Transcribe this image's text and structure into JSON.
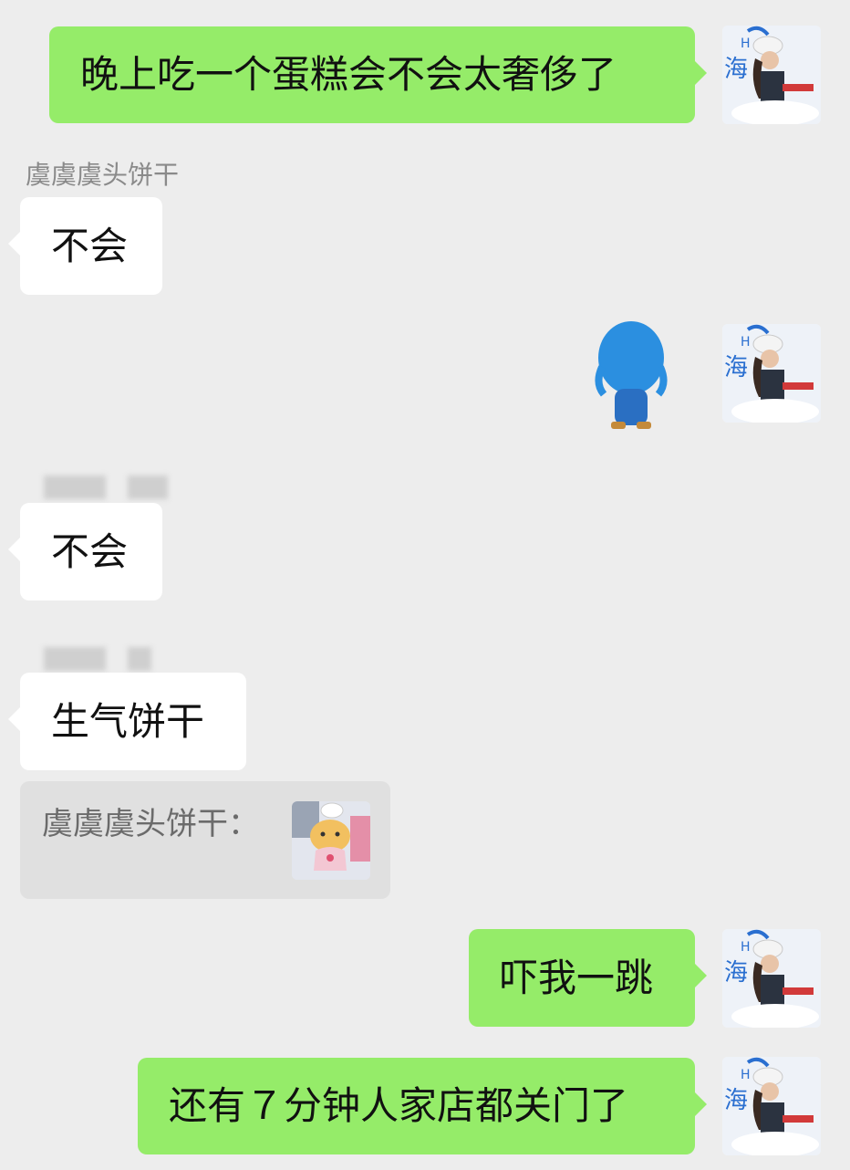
{
  "chat": {
    "messages": [
      {
        "from": "me",
        "text": "晚上吃一个蛋糕会不会太奢侈了"
      },
      {
        "from": "other",
        "sender": "虞虞虞头饼干",
        "text": "不会"
      },
      {
        "from": "me",
        "type": "sticker",
        "sticker": "blue-character-sticker"
      },
      {
        "from": "other",
        "sender": "",
        "text": "不会"
      },
      {
        "from": "other",
        "sender": "",
        "text": "生气饼干"
      },
      {
        "from": "me",
        "text": "吓我一跳"
      },
      {
        "from": "me",
        "text": "还有７分钟人家店都关门了"
      }
    ],
    "quote": {
      "sender_prefix": "虞虞虞头饼干：",
      "thumbnail": "chef-tiger-sticker"
    }
  },
  "colors": {
    "background": "#ededed",
    "my_bubble": "#95ec69",
    "their_bubble": "#ffffff",
    "quote_box": "#e0e0e0"
  }
}
